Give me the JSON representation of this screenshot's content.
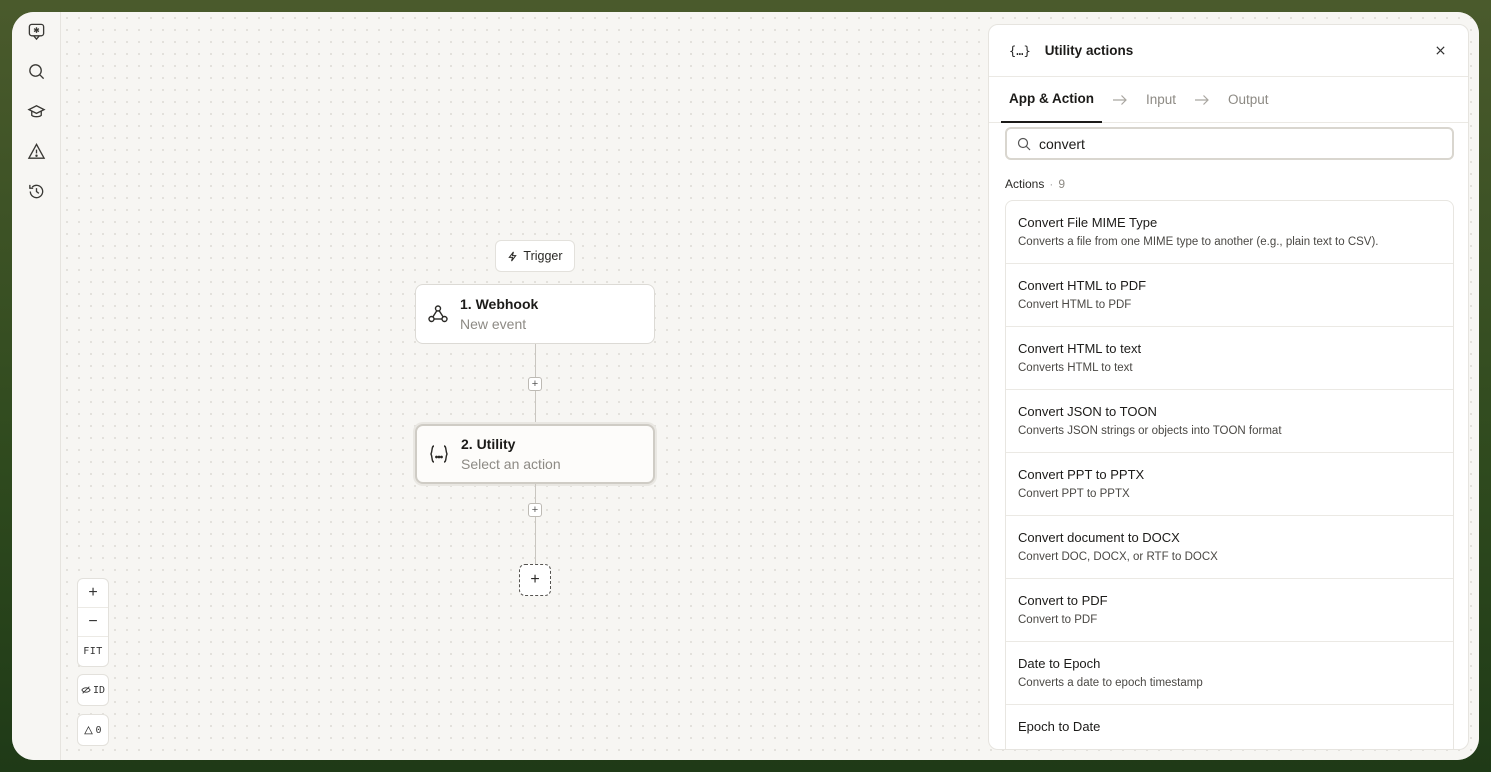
{
  "rail": {
    "items": [
      "assistant-icon",
      "search-icon",
      "learn-icon",
      "alert-icon",
      "history-icon"
    ]
  },
  "canvas": {
    "trigger_label": "Trigger",
    "nodes": [
      {
        "title": "1. Webhook",
        "subtitle": "New event",
        "icon": "webhook-icon"
      },
      {
        "title": "2. Utility",
        "subtitle": "Select an action",
        "icon": "braces-icon"
      }
    ],
    "zoom": {
      "in": "+",
      "out": "−",
      "fit": "FIT"
    },
    "id_toggle_label": "ID",
    "warnings_count": "0"
  },
  "panel": {
    "icon_glyph": "{…}",
    "title": "Utility actions",
    "tabs": [
      {
        "label": "App & Action"
      },
      {
        "label": "Input"
      },
      {
        "label": "Output"
      }
    ],
    "search": {
      "value": "convert",
      "placeholder": ""
    },
    "section": {
      "label": "Actions",
      "separator": "·",
      "count": "9"
    },
    "items": [
      {
        "title": "Convert File MIME Type",
        "desc": "Converts a file from one MIME type to another (e.g., plain text to CSV)."
      },
      {
        "title": "Convert HTML to PDF",
        "desc": "Convert HTML to PDF"
      },
      {
        "title": "Convert HTML to text",
        "desc": "Converts HTML to text"
      },
      {
        "title": "Convert JSON to TOON",
        "desc": "Converts JSON strings or objects into TOON format"
      },
      {
        "title": "Convert PPT to PPTX",
        "desc": "Convert PPT to PPTX"
      },
      {
        "title": "Convert document to DOCX",
        "desc": "Convert DOC, DOCX, or RTF to DOCX"
      },
      {
        "title": "Convert to PDF",
        "desc": "Convert to PDF"
      },
      {
        "title": "Date to Epoch",
        "desc": "Converts a date to epoch timestamp"
      },
      {
        "title": "Epoch to Date",
        "desc": ""
      }
    ]
  }
}
